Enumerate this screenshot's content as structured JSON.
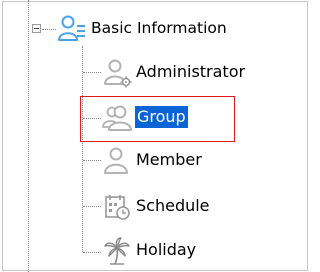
{
  "tree": {
    "root": {
      "label": "Basic Information",
      "icon": "users-list-icon",
      "expanded": true
    },
    "children": [
      {
        "key": "administrator",
        "label": "Administrator",
        "icon": "admin-user-gear-icon",
        "selected": false
      },
      {
        "key": "group",
        "label": "Group",
        "icon": "group-users-icon",
        "selected": true
      },
      {
        "key": "member",
        "label": "Member",
        "icon": "member-user-icon",
        "selected": false
      },
      {
        "key": "schedule",
        "label": "Schedule",
        "icon": "calendar-clock-icon",
        "selected": false
      },
      {
        "key": "holiday",
        "label": "Holiday",
        "icon": "palm-tree-icon",
        "selected": false
      }
    ]
  },
  "colors": {
    "selection": "#0a64d6",
    "highlight_box": "#e01b1b",
    "icon_gray": "#b3b3b3",
    "root_icon_blue": "#4aa3ea"
  }
}
